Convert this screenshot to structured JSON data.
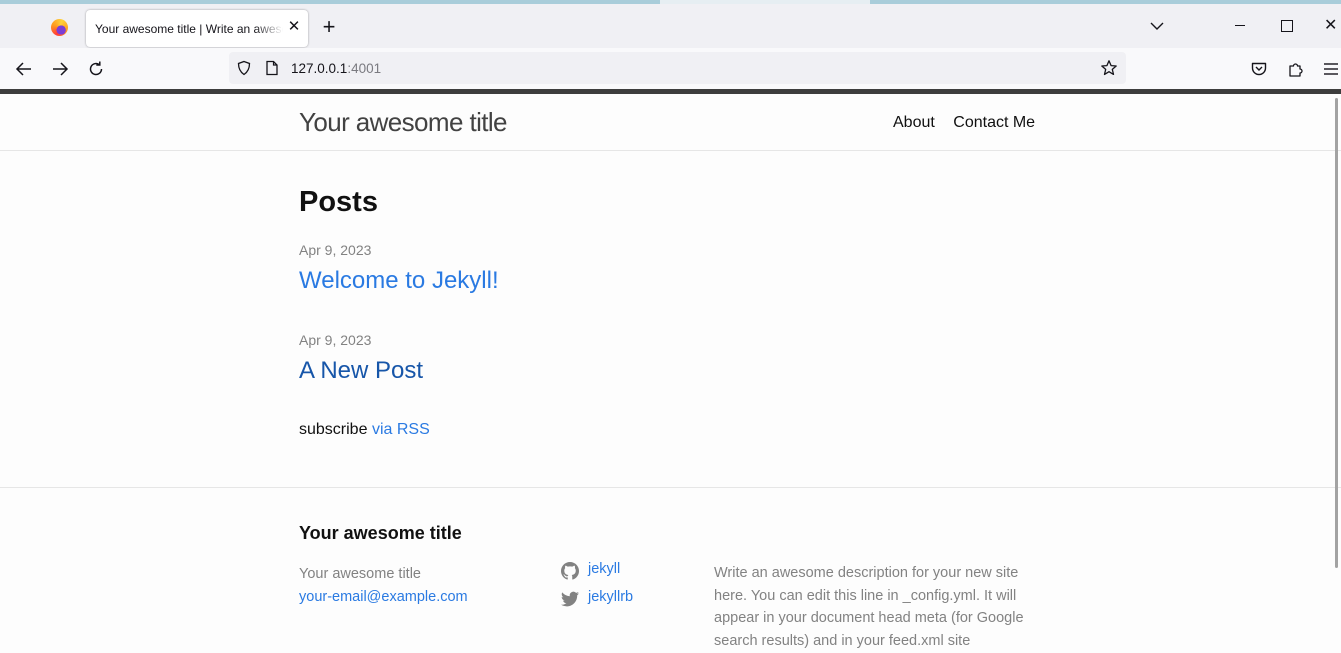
{
  "browser": {
    "tab_title": "Your awesome title | Write an awesome description for your new site here.",
    "new_tab_symbol": "+",
    "close_symbol": "✕",
    "url_host": "127.0.0.1",
    "url_port": ":4001",
    "icons": [
      "firefox-logo-icon",
      "tab-close-icon",
      "new-tab-icon",
      "list-tabs-chevron-icon",
      "minimize-icon",
      "maximize-icon",
      "close-window-icon",
      "back-arrow-icon",
      "forward-arrow-icon",
      "reload-icon",
      "shield-icon",
      "page-icon",
      "bookmark-star-icon",
      "pocket-icon",
      "extensions-icon",
      "menu-icon"
    ]
  },
  "header": {
    "site_title": "Your awesome title",
    "nav": [
      "About",
      "Contact Me"
    ]
  },
  "main": {
    "heading": "Posts",
    "posts": [
      {
        "date": "Apr 9, 2023",
        "title": "Welcome to Jekyll!"
      },
      {
        "date": "Apr 9, 2023",
        "title": "A New Post"
      }
    ],
    "subscribe_text": "subscribe",
    "rss_link": "via RSS"
  },
  "footer": {
    "heading": "Your awesome title",
    "name": "Your awesome title",
    "email": "your-email@example.com",
    "social": [
      {
        "icon": "github-icon",
        "label": "jekyll"
      },
      {
        "icon": "twitter-icon",
        "label": "jekyllrb"
      }
    ],
    "description": "Write an awesome description for your new site here. You can edit this line in _config.yml. It will appear in your document head meta (for Google search results) and in your feed.xml site"
  },
  "colors": {
    "link": "#2a7ae2",
    "link_visited": "#1756a9",
    "muted": "#828282",
    "text": "#111111"
  }
}
